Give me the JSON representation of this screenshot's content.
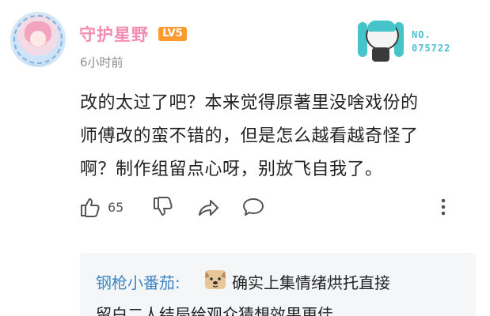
{
  "user": {
    "name": "守护星野",
    "level": "LV5",
    "time": "6小时前"
  },
  "badge": {
    "label": "NO.",
    "number": "075722"
  },
  "comment": {
    "lines": [
      "改的太过了吧？本来觉得原著里没啥戏份的",
      "师傅改的蛮不错的，但是怎么越看越奇怪了",
      "啊？制作组留点心呀，别放飞自我了。"
    ]
  },
  "actions": {
    "like_count": "65",
    "icons": [
      "thumbs-up-icon",
      "thumbs-down-icon",
      "share-icon",
      "comment-icon",
      "more-icon"
    ]
  },
  "reply": {
    "author": "钢枪小番茄:",
    "emoji": "dog-face-emoji",
    "line1": "确实上集情绪烘托直接",
    "line2": "留白二人结局给观众猜想效果更佳"
  },
  "colors": {
    "username": "#f28cb0",
    "level_badge": "#ff9a2e",
    "reply_author": "#3f86c7",
    "badge_number": "#4bbfcf"
  }
}
